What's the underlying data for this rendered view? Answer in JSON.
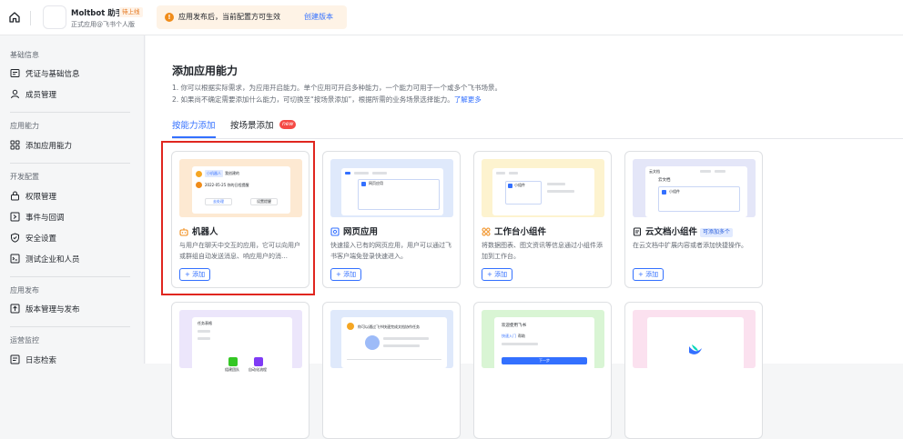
{
  "topbar": {
    "app_name": "Moltbot 助手",
    "status_badge": "待上线",
    "app_subtitle": "正式应用@飞书个人版",
    "notice_text": "应用发布后，当前配置方可生效",
    "notice_link": "创建版本"
  },
  "sidebar": {
    "groups": [
      {
        "label": "基础信息",
        "items": [
          "凭证与基础信息",
          "成员管理"
        ]
      },
      {
        "label": "应用能力",
        "items": [
          "添加应用能力"
        ]
      },
      {
        "label": "开发配置",
        "items": [
          "权限管理",
          "事件与回调",
          "安全设置",
          "测试企业和人员"
        ]
      },
      {
        "label": "应用发布",
        "items": [
          "版本管理与发布"
        ]
      },
      {
        "label": "运营监控",
        "items": [
          "日志检索"
        ]
      }
    ]
  },
  "main": {
    "title": "添加应用能力",
    "desc1": "1. 你可以根据实际需求，为应用开启能力。单个应用可开启多种能力，一个能力可用于一个或多个飞书场景。",
    "desc2": "2. 如果尚不确定需要添加什么能力，可切换至“按场景添加”，根据所需的业务场景选择能力。",
    "learn_more": "了解更多",
    "tabs": [
      "按能力添加",
      "按场景添加"
    ],
    "new_badge": "new",
    "cards": [
      {
        "title": "机器人",
        "desc": "与用户在聊天中交互的应用，它可以向用户或群组自动发送消息、响应用户的消…",
        "button": "+ 添加"
      },
      {
        "title": "网页应用",
        "desc": "快速接入已有的网页应用，用户可以通过飞书客户端免登录快速进入。",
        "button": "+ 添加"
      },
      {
        "title": "工作台小组件",
        "desc": "将数据图表、图文资讯等信息通过小组件添加到工作台。",
        "button": "+ 添加"
      },
      {
        "title": "云文档小组件",
        "tag": "可添加多个",
        "desc": "在云文档中扩展内容或者添加快捷操作。",
        "button": "+ 添加"
      }
    ],
    "preview_texts": {
      "bot_chip": "小机器人",
      "bot_name": "我创建的",
      "bot_date": "2022-05-25 你的日程提醒",
      "bot_btn1": "去处理",
      "bot_btn2": "设置提醒",
      "web_label": "网页应用",
      "widget_label": "小组件",
      "doc_label": "云文档",
      "doc_widget": "小组件",
      "row2_a_title": "任务表格",
      "row2_a_btn1": "组建团队",
      "row2_a_btn2": "自动化流程",
      "row2_b_text": "你可以通过飞书快速完成文档协作任务",
      "row2_c_title": "欢迎使用飞书",
      "row2_c_tab1": "快速入门",
      "row2_c_tab2": "帮助",
      "row2_c_btn": "下一步"
    }
  },
  "colors": {
    "accent": "#3370ff",
    "highlight_box": "#e0261f",
    "notice_bg": "#fef3e6",
    "warning": "#f08c1a"
  }
}
